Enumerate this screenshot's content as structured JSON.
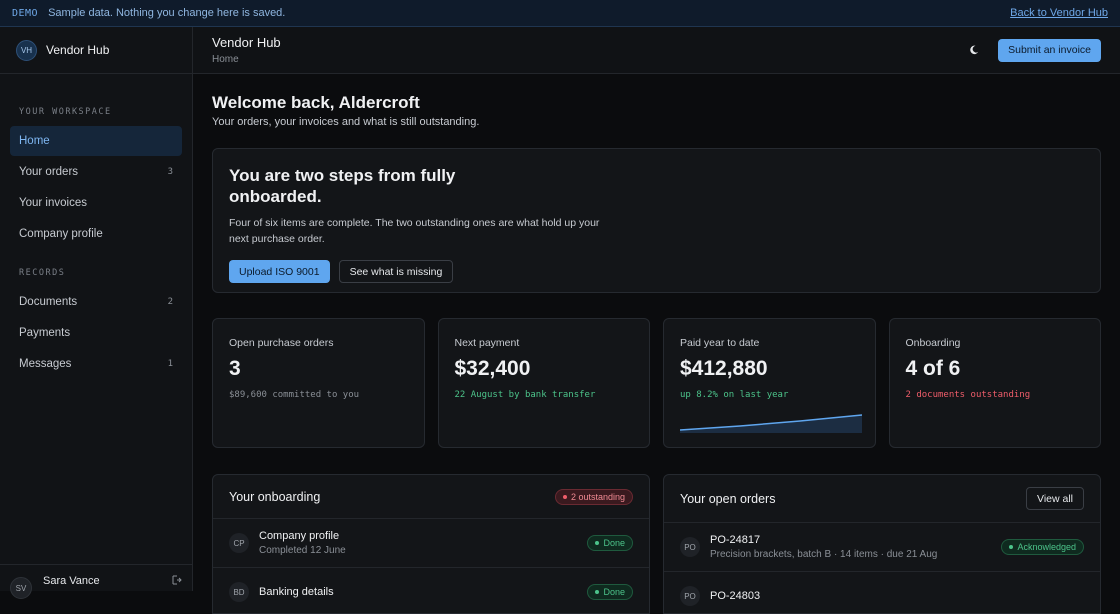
{
  "banner": {
    "tag": "DEMO",
    "message": "Sample data. Nothing you change here is saved.",
    "back_link": "Back to Vendor Hub"
  },
  "sidebar": {
    "brand_initials": "VH",
    "brand_name": "Vendor Hub",
    "workspace_label": "YOUR WORKSPACE",
    "workspace_items": [
      {
        "label": "Home",
        "count": ""
      },
      {
        "label": "Your orders",
        "count": "3"
      },
      {
        "label": "Your invoices",
        "count": ""
      },
      {
        "label": "Company profile",
        "count": ""
      }
    ],
    "records_label": "RECORDS",
    "records_items": [
      {
        "label": "Documents",
        "count": "2"
      },
      {
        "label": "Payments",
        "count": ""
      },
      {
        "label": "Messages",
        "count": "1"
      }
    ],
    "user": {
      "initials": "SV",
      "name": "Sara Vance",
      "exit_icon": "logout-icon"
    }
  },
  "topbar": {
    "title": "Vendor Hub",
    "breadcrumb": "Home",
    "theme_icon": "moon-icon",
    "submit_label": "Submit an invoice"
  },
  "welcome": {
    "title": "Welcome back, Aldercroft",
    "subtitle": "Your orders, your invoices and what is still outstanding."
  },
  "hero": {
    "title": "You are two steps from fully onboarded.",
    "body": "Four of six items are complete. The two outstanding ones are what hold up your next purchase order.",
    "primary_label": "Upload ISO 9001",
    "secondary_label": "See what is missing"
  },
  "stats": [
    {
      "label": "Open purchase orders",
      "value": "3",
      "sub": "$89,600 committed to you"
    },
    {
      "label": "Next payment",
      "value": "$32,400",
      "sub": "22 August by bank transfer"
    },
    {
      "label": "Paid year to date",
      "value": "$412,880",
      "sub": "up 8.2% on last year"
    },
    {
      "label": "Onboarding",
      "value": "4 of 6",
      "sub": "2 documents outstanding"
    }
  ],
  "colors": {
    "accent": "#5fa6ef",
    "positive": "#4cc38a",
    "negative": "#ef5d6a"
  },
  "onboarding": {
    "title": "Your onboarding",
    "badge": "2 outstanding",
    "items": [
      {
        "initials": "CP",
        "title": "Company profile",
        "sub": "Completed 12 June",
        "status": "Done"
      },
      {
        "initials": "BD",
        "title": "Banking details",
        "sub": "",
        "status": "Done"
      }
    ]
  },
  "orders": {
    "title": "Your open orders",
    "view_all": "View all",
    "items": [
      {
        "initials": "PO",
        "title": "PO-24817",
        "sub": "Precision brackets, batch B · 14 items · due 21 Aug",
        "status": "Acknowledged"
      },
      {
        "initials": "PO",
        "title": "PO-24803",
        "sub": "",
        "status": ""
      }
    ]
  }
}
